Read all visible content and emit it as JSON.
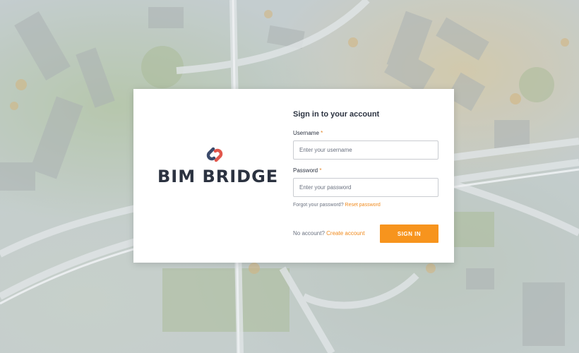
{
  "brand": {
    "name": "BIM BRIDGE",
    "icon": "link-chain-icon",
    "colors": {
      "dark": "#2b3240",
      "accent": "#e2574c",
      "navy": "#3b4a6b"
    }
  },
  "form": {
    "title": "Sign in to your account",
    "username_label": "Username",
    "username_placeholder": "Enter your username",
    "password_label": "Password",
    "password_placeholder": "Enter your password",
    "required_mark": "*",
    "forgot_text": "Forgot your password?",
    "reset_link": "Reset password",
    "no_account_text": "No account?",
    "create_link": "Create account",
    "submit_label": "SIGN IN"
  },
  "colors": {
    "button": "#f7941d",
    "link": "#f08a1c"
  }
}
